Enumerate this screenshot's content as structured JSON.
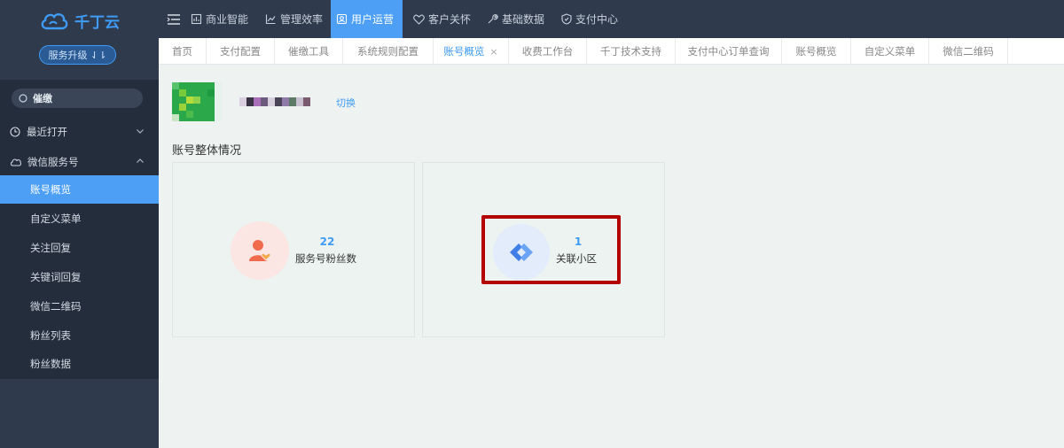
{
  "brand": {
    "name": "千丁云",
    "upgrade_label": "服务升级 ⇃⇂"
  },
  "search": {
    "value": "催缴"
  },
  "sidebar": {
    "recent": {
      "label": "最近打开"
    },
    "wechat_group": {
      "label": "微信服务号"
    },
    "items": [
      {
        "label": "账号概览",
        "active": true
      },
      {
        "label": "自定义菜单"
      },
      {
        "label": "关注回复"
      },
      {
        "label": "关键词回复"
      },
      {
        "label": "微信二维码"
      },
      {
        "label": "粉丝列表"
      },
      {
        "label": "粉丝数据"
      }
    ]
  },
  "topnav": [
    {
      "label": "商业智能",
      "icon": "business-intelligence-icon"
    },
    {
      "label": "管理效率",
      "icon": "trend-chart-icon"
    },
    {
      "label": "用户运营",
      "icon": "user-operation-icon",
      "active": true
    },
    {
      "label": "客户关怀",
      "icon": "heart-icon"
    },
    {
      "label": "基础数据",
      "icon": "wrench-icon"
    },
    {
      "label": "支付中心",
      "icon": "shield-icon"
    }
  ],
  "tabs": [
    {
      "label": "首页"
    },
    {
      "label": "支付配置"
    },
    {
      "label": "催缴工具"
    },
    {
      "label": "系统规则配置"
    },
    {
      "label": "账号概览",
      "active": true,
      "close": "×"
    },
    {
      "label": "收费工作台"
    },
    {
      "label": "千丁技术支持"
    },
    {
      "label": "支付中心订单查询"
    },
    {
      "label": "账号概览"
    },
    {
      "label": "自定义菜单"
    },
    {
      "label": "微信二维码"
    }
  ],
  "account": {
    "switch_label": "切换"
  },
  "overview": {
    "title": "账号整体情况",
    "fans": {
      "value": "22",
      "label": "服务号粉丝数"
    },
    "communities": {
      "value": "1",
      "label": "关联小区"
    }
  },
  "colors": {
    "accent": "#4c9ff5",
    "sidebar": "#2f3b4c",
    "highlight": "#b30000"
  }
}
